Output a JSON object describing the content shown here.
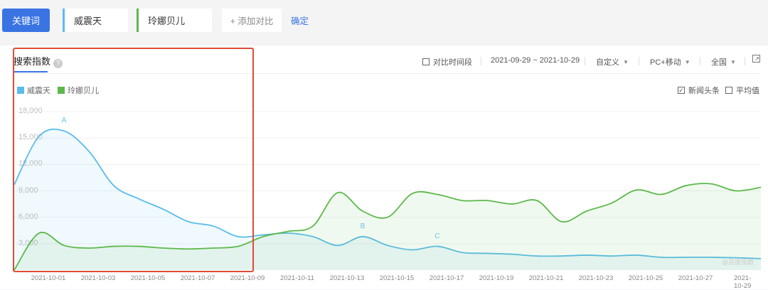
{
  "toolbar": {
    "keyword_label": "关键词",
    "keywords": [
      {
        "name": "威震天",
        "color": "#5bbcea"
      },
      {
        "name": "玲娜贝儿",
        "color": "#5cb94a"
      }
    ],
    "add_compare": "+ 添加对比",
    "confirm": "确定"
  },
  "panel": {
    "title": "搜索指数",
    "help_icon": "?",
    "compare_period": "对比时间段",
    "date_range": "2021-09-29 ~ 2021-10-29",
    "custom": "自定义",
    "device": "PC+移动",
    "region": "全国",
    "news": "新闻头条",
    "news_checked": true,
    "average": "平均值",
    "average_checked": false,
    "watermark": "@百度指数"
  },
  "chart_data": {
    "type": "area",
    "ylim": [
      0,
      18000
    ],
    "yticks": [
      "3,000",
      "6,000",
      "9,000",
      "12,000",
      "15,000",
      "18,000"
    ],
    "xticks": [
      "2021-10-01",
      "2021-10-03",
      "2021-10-05",
      "2021-10-07",
      "2021-10-09",
      "2021-10-11",
      "2021-10-13",
      "2021-10-15",
      "2021-10-17",
      "2021-10-19",
      "2021-10-21",
      "2021-10-23",
      "2021-10-25",
      "2021-10-27",
      "2021-10-29"
    ],
    "x_start": "2021-09-29",
    "x_end": "2021-10-29",
    "series": [
      {
        "name": "威震天",
        "color": "#5bbcea",
        "values": [
          9700,
          15200,
          15800,
          13500,
          9600,
          8100,
          6900,
          5500,
          5000,
          3800,
          4000,
          4200,
          3800,
          2800,
          3800,
          2800,
          2300,
          2700,
          2000,
          1900,
          1800,
          1600,
          1600,
          1700,
          1600,
          1700,
          1450,
          1450,
          1450,
          1400,
          1300
        ]
      },
      {
        "name": "玲娜贝儿",
        "color": "#5cb94a",
        "values": [
          0,
          4200,
          2800,
          2500,
          2700,
          2700,
          2500,
          2400,
          2500,
          2700,
          3800,
          4400,
          5000,
          8800,
          6700,
          6000,
          8700,
          8600,
          7900,
          7900,
          7500,
          7900,
          5500,
          6700,
          7600,
          9100,
          8600,
          9600,
          9800,
          9000,
          9400
        ]
      }
    ],
    "annotations": [
      {
        "label": "A",
        "index": 2
      },
      {
        "label": "B",
        "index": 14
      },
      {
        "label": "C",
        "index": 17
      }
    ]
  }
}
